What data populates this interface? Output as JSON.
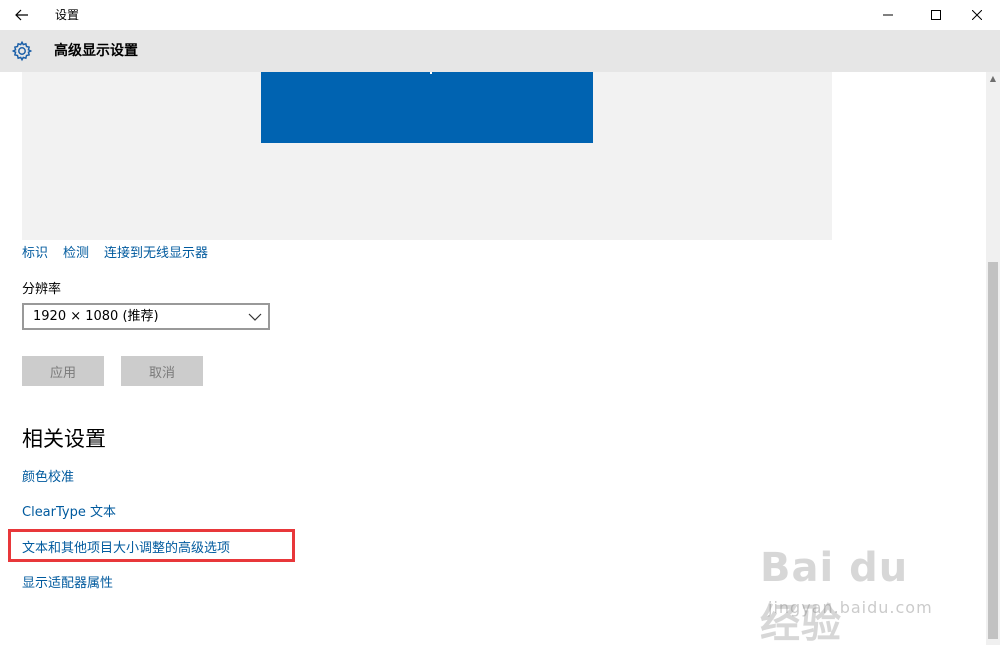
{
  "window": {
    "app_title": "设置",
    "back_icon": "back-arrow-icon",
    "minimize_icon": "minimize-icon",
    "maximize_icon": "maximize-icon",
    "close_icon": "close-icon"
  },
  "header": {
    "title": "高级显示设置",
    "icon": "gear-icon"
  },
  "display_links": [
    "标识",
    "检测",
    "连接到无线显示器"
  ],
  "resolution": {
    "label": "分辨率",
    "value": "1920 × 1080 (推荐)"
  },
  "buttons": {
    "apply": "应用",
    "cancel": "取消"
  },
  "related": {
    "title": "相关设置",
    "links": [
      "颜色校准",
      "ClearType 文本",
      "文本和其他项目大小调整的高级选项",
      "显示适配器属性"
    ]
  },
  "watermark": {
    "logo": "Bai du 经验",
    "url": "jingyan.baidu.com"
  },
  "colors": {
    "accent": "#0063b1",
    "link": "#005a9e",
    "highlight": "#e8373a"
  }
}
